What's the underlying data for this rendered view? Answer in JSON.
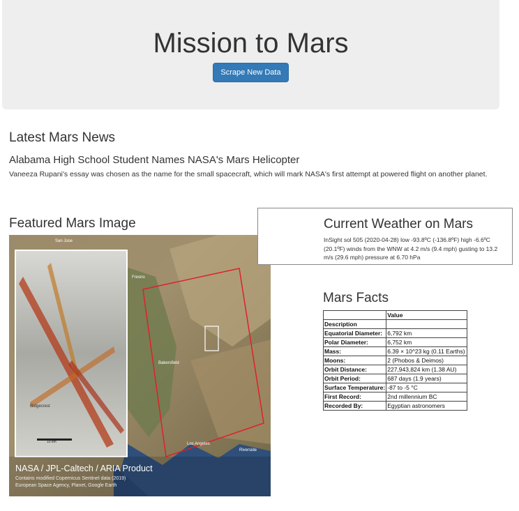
{
  "jumbotron": {
    "title": "Mission to Mars",
    "button_label": "Scrape New Data"
  },
  "news": {
    "heading": "Latest Mars News",
    "title": "Alabama High School Student Names NASA's Mars Helicopter",
    "paragraph": "Vaneeza Rupani's essay was chosen as the name for the small spacecraft, which will mark NASA's first attempt at powered flight on another planet."
  },
  "featured": {
    "heading": "Featured Mars Image",
    "image_caption": "NASA / JPL-Caltech / ARIA Product",
    "image_credit_1": "Contains modified Copernicus Sentinel data (2019)",
    "image_credit_2": "European Space Agency, Planet, Google Earth",
    "place_labels": [
      "San Jose",
      "Fresno",
      "Bakersfield",
      "Los Angeles",
      "Riverside",
      "Ridgecrest"
    ],
    "scale_label": "10 km"
  },
  "weather": {
    "heading": "Current Weather on Mars",
    "text": "InSight sol 505 (2020-04-28) low -93.8ºC (-136.8ºF) high -6.6ºC (20.1ºF) winds from the WNW at 4.2 m/s (9.4 mph) gusting to 13.2 m/s (29.6 mph) pressure at 6.70 hPa"
  },
  "facts": {
    "heading": "Mars Facts",
    "col_header": "Value",
    "row_header": "Description",
    "rows": [
      {
        "label": "Equatorial Diameter:",
        "value": "6,792 km"
      },
      {
        "label": "Polar Diameter:",
        "value": "6,752 km"
      },
      {
        "label": "Mass:",
        "value": "6.39 × 10^23 kg (0.11 Earths)"
      },
      {
        "label": "Moons:",
        "value": "2 (Phobos & Deimos)"
      },
      {
        "label": "Orbit Distance:",
        "value": "227,943,824 km (1.38 AU)"
      },
      {
        "label": "Orbit Period:",
        "value": "687 days (1.9 years)"
      },
      {
        "label": "Surface Temperature:",
        "value": "-87 to -5 °C"
      },
      {
        "label": "First Record:",
        "value": "2nd millennium BC"
      },
      {
        "label": "Recorded By:",
        "value": "Egyptian astronomers"
      }
    ]
  },
  "colors": {
    "jumbotron_bg": "#eeeeee",
    "button_bg": "#337ab7",
    "text": "#333333"
  }
}
